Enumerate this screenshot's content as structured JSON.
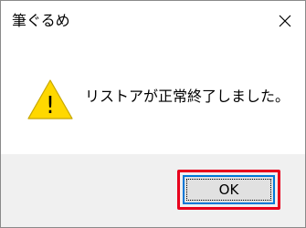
{
  "window": {
    "title": "筆ぐるめ"
  },
  "message": {
    "text": "リストアが正常終了しました。",
    "icon": "warning-icon",
    "icon_glyph": "!"
  },
  "buttons": {
    "ok_label": "OK"
  },
  "colors": {
    "warning_fill": "#ffd800",
    "highlight_border": "#e8001c",
    "focus_border": "#0078d7",
    "footer_bg": "#f0f0f0"
  }
}
